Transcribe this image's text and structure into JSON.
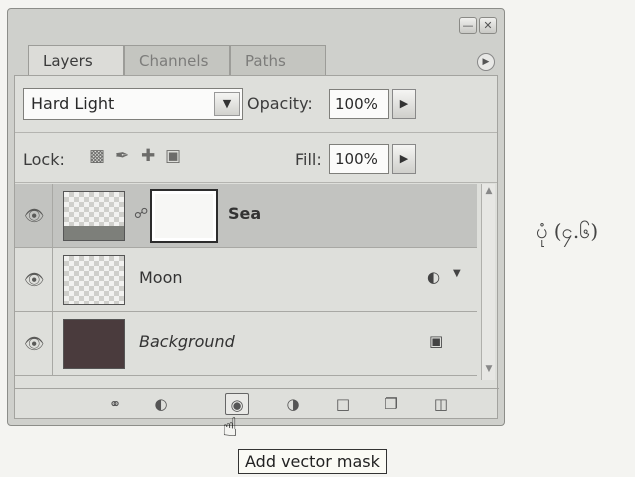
{
  "tabs": [
    "Layers",
    "Channels",
    "Paths"
  ],
  "blend_mode": "Hard Light",
  "opacity": {
    "label": "Opacity:",
    "value": "100%"
  },
  "lock_label": "Lock:",
  "fill": {
    "label": "Fill:",
    "value": "100%"
  },
  "layers": [
    {
      "name": "Sea",
      "style": "bold",
      "selected": true,
      "has_mask": true
    },
    {
      "name": "Moon",
      "style": "normal",
      "selected": false,
      "has_fx": true
    },
    {
      "name": "Background",
      "style": "italic",
      "selected": false,
      "locked": true
    }
  ],
  "tooltip": "Add vector mask",
  "caption": "ပုံ (၄.၆)"
}
